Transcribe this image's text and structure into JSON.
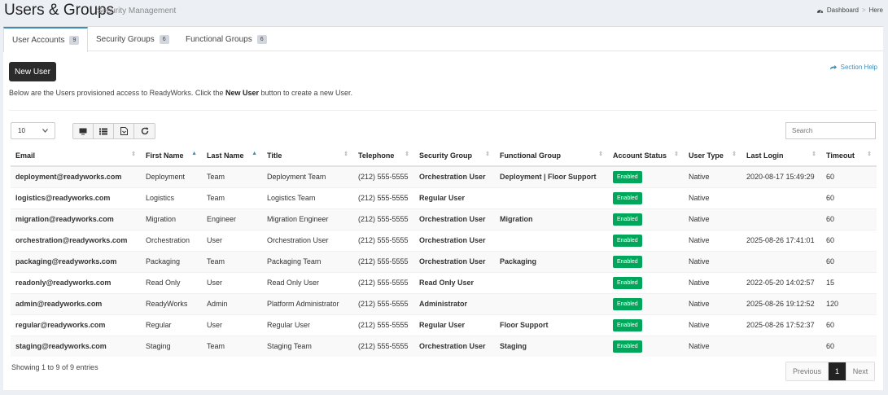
{
  "header": {
    "title": "Users & Groups",
    "subtitle": "Security Management",
    "breadcrumb": {
      "home": "Dashboard",
      "separator": ">",
      "current": "Here"
    }
  },
  "tabs": [
    {
      "label": "User Accounts",
      "count": "9"
    },
    {
      "label": "Security Groups",
      "count": "6"
    },
    {
      "label": "Functional Groups",
      "count": "6"
    }
  ],
  "actions": {
    "new_user": "New User",
    "help": "Section Help",
    "intro_before": "Below are the Users provisioned access to ReadyWorks. Click the ",
    "intro_bold": "New User",
    "intro_after": " button to create a new User."
  },
  "table_controls": {
    "page_size": "10",
    "search_placeholder": "Search",
    "toolbar_icons": [
      "monitor-icon",
      "list-icon",
      "file-export-icon",
      "refresh-icon"
    ]
  },
  "table": {
    "columns": [
      "Email",
      "First Name",
      "Last Name",
      "Title",
      "Telephone",
      "Security Group",
      "Functional Group",
      "Account Status",
      "User Type",
      "Last Login",
      "Timeout"
    ],
    "rows": [
      [
        "deployment@readyworks.com",
        "Deployment",
        "Team",
        "Deployment Team",
        "(212) 555-5555",
        "Orchestration User",
        "Deployment | Floor Support",
        "Enabled",
        "Native",
        "2020-08-17 15:49:29",
        "60"
      ],
      [
        "logistics@readyworks.com",
        "Logistics",
        "Team",
        "Logistics Team",
        "(212) 555-5555",
        "Regular User",
        "",
        "Enabled",
        "Native",
        "",
        "60"
      ],
      [
        "migration@readyworks.com",
        "Migration",
        "Engineer",
        "Migration Engineer",
        "(212) 555-5555",
        "Orchestration User",
        "Migration",
        "Enabled",
        "Native",
        "",
        "60"
      ],
      [
        "orchestration@readyworks.com",
        "Orchestration",
        "User",
        "Orchestration User",
        "(212) 555-5555",
        "Orchestration User",
        "",
        "Enabled",
        "Native",
        "2025-08-26 17:41:01",
        "60"
      ],
      [
        "packaging@readyworks.com",
        "Packaging",
        "Team",
        "Packaging Team",
        "(212) 555-5555",
        "Orchestration User",
        "Packaging",
        "Enabled",
        "Native",
        "",
        "60"
      ],
      [
        "readonly@readyworks.com",
        "Read Only",
        "User",
        "Read Only User",
        "(212) 555-5555",
        "Read Only User",
        "",
        "Enabled",
        "Native",
        "2022-05-20 14:02:57",
        "15"
      ],
      [
        "admin@readyworks.com",
        "ReadyWorks",
        "Admin",
        "Platform Administrator",
        "(212) 555-5555",
        "Administrator",
        "",
        "Enabled",
        "Native",
        "2025-08-26 19:12:52",
        "120"
      ],
      [
        "regular@readyworks.com",
        "Regular",
        "User",
        "Regular User",
        "(212) 555-5555",
        "Regular User",
        "Floor Support",
        "Enabled",
        "Native",
        "2025-08-26 17:52:37",
        "60"
      ],
      [
        "staging@readyworks.com",
        "Staging",
        "Team",
        "Staging Team",
        "(212) 555-5555",
        "Orchestration User",
        "Staging",
        "Enabled",
        "Native",
        "",
        "60"
      ]
    ]
  },
  "footer": {
    "info": "Showing 1 to 9 of 9 entries",
    "previous": "Previous",
    "current_page": "1",
    "next": "Next"
  },
  "colors": {
    "accent": "#3c8dbc",
    "enabled": "#00a65a",
    "dark_button": "#2b2b2b"
  }
}
